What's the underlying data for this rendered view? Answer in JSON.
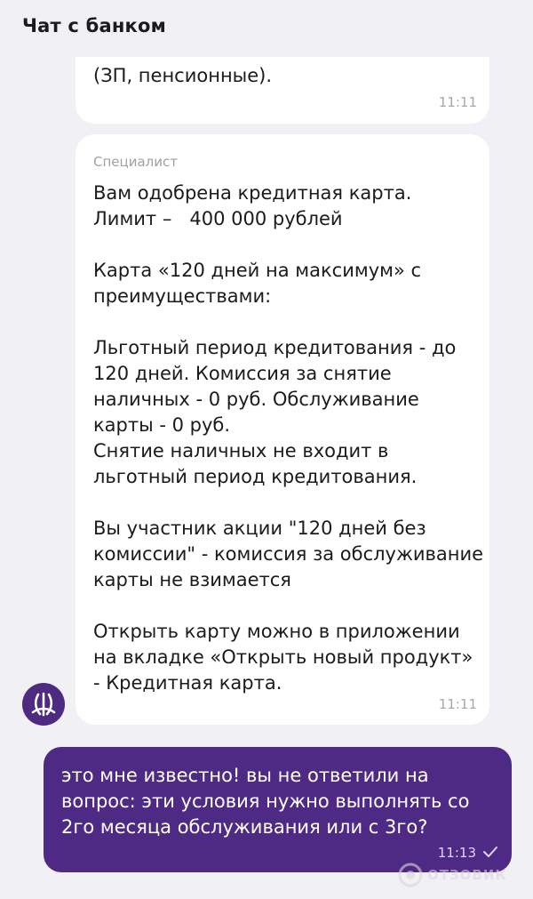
{
  "header": {
    "title": "Чат с банком"
  },
  "messages": {
    "previous": {
      "text": "(ЗП, пенсионные).",
      "time": "11:11"
    },
    "specialist": {
      "sender": "Специалист",
      "text": "Вам одобрена кредитная карта.\nЛимит –   400 000 рублей\n\nКарта «120 дней на максимум» с преимуществами:\n\nЛьготный период кредитования - до 120 дней. Комиссия за снятие наличных - 0 руб. Обслуживание карты - 0 руб.\nСнятие наличных не входит в льготный период кредитования.\n\nВы участник акции \"120 дней без комиссии\" - комиссия за обслуживание карты не взимается\n\nОткрыть карту можно в приложении на вкладке «Открыть новый продукт» - Кредитная карта.",
      "time": "11:11"
    },
    "user": {
      "text": "это мне известно! вы не ответили на вопрос: эти условия нужно выполнять со 2го месяца обслуживания или с 3го?",
      "time": "11:13"
    }
  },
  "watermark": {
    "text": "ОТЗОВИК"
  },
  "colors": {
    "background": "#f1f0f5",
    "incoming_bubble": "#ffffff",
    "outgoing_bubble": "#4f2a84",
    "avatar": "#4d2b80"
  }
}
